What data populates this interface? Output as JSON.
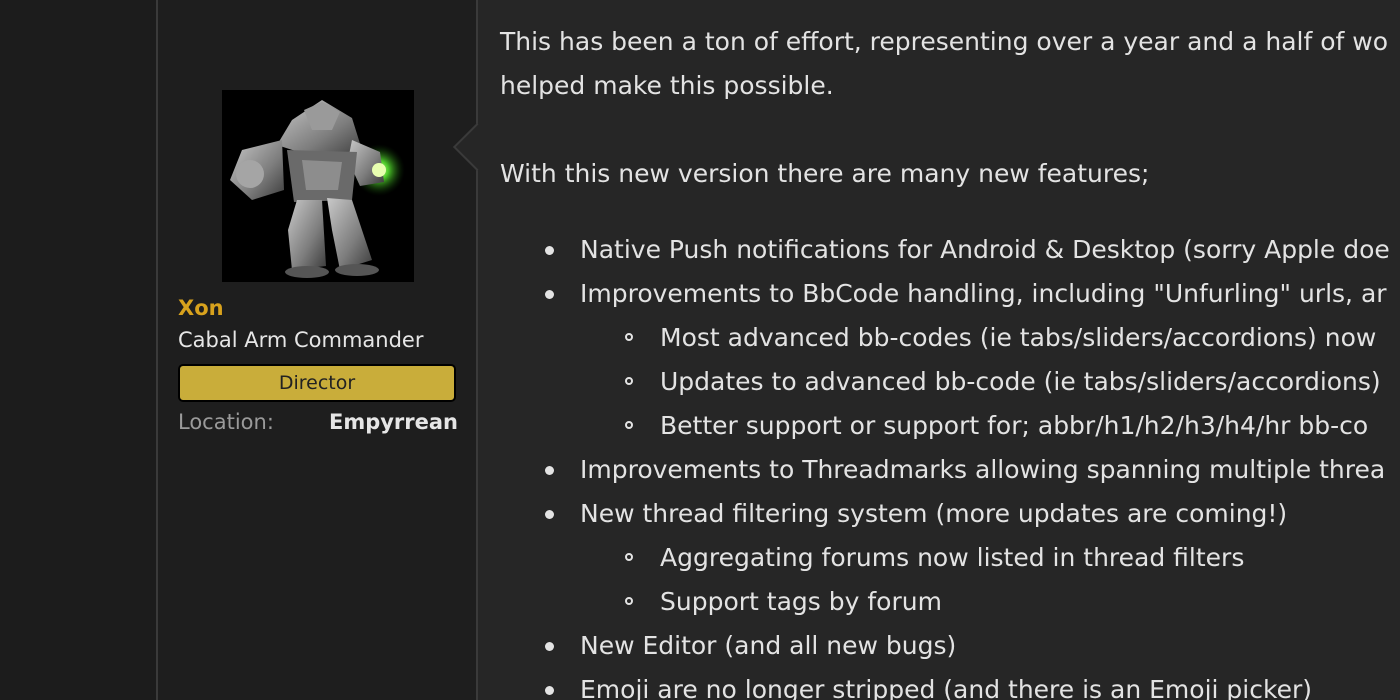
{
  "user": {
    "name": "Xon",
    "title": "Cabal Arm Commander",
    "banner": "Director",
    "location_label": "Location:",
    "location_value": "Empyrrean",
    "avatar_icon": "mech-robot-avatar"
  },
  "colors": {
    "username": "#d8a21d",
    "banner": "#c9ad3a",
    "background": "#1e1e1e",
    "message_bg": "#262626"
  },
  "message": {
    "intro_line1": "This has been a ton of effort, representing over a year and a half of wo",
    "intro_line2": "helped make this possible.",
    "features_intro": "With this new version there are many new features;",
    "items": [
      {
        "text": "Native Push notifications for Android & Desktop (sorry Apple doe"
      },
      {
        "text": "Improvements to BbCode handling, including \"Unfurling\" urls, ar",
        "sub": [
          "Most advanced bb-codes (ie tabs/sliders/accordions) now",
          "Updates to advanced bb-code (ie tabs/sliders/accordions)",
          "Better support or support for; abbr/h1/h2/h3/h4/hr bb-co"
        ]
      },
      {
        "text": "Improvements to Threadmarks allowing spanning multiple threa"
      },
      {
        "text": "New thread filtering system (more updates are coming!)",
        "sub": [
          "Aggregating forums now listed in thread filters",
          "Support tags by forum"
        ]
      },
      {
        "text": "New Editor (and all new bugs)"
      },
      {
        "text": "Emoji are no longer stripped (and there is an Emoji picker)"
      }
    ]
  }
}
